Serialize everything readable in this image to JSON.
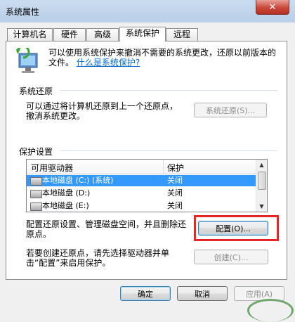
{
  "window": {
    "title": "系统属性",
    "close_label": "✕"
  },
  "tabs": [
    {
      "label": "计算机名"
    },
    {
      "label": "硬件"
    },
    {
      "label": "高级"
    },
    {
      "label": "系统保护"
    },
    {
      "label": "远程"
    }
  ],
  "info": {
    "text": "可以使用系统保护来撤消不需要的系统更改，还原以前版本的文件。",
    "link": "什么是系统保护?"
  },
  "restore": {
    "group_label": "系统还原",
    "description": "可以通过将计算机还原到上一个还原点，撤消系统更改。",
    "button": "系统还原(S)..."
  },
  "protection": {
    "group_label": "保护设置",
    "columns": {
      "drive": "可用驱动器",
      "protect": "保护"
    },
    "drives": [
      {
        "name": "本地磁盘 (C:) (系统)",
        "status": "关闭"
      },
      {
        "name": "本地磁盘 (D:)",
        "status": "关闭"
      },
      {
        "name": "本地磁盘 (E:)",
        "status": "关闭"
      }
    ],
    "configure_text": "配置还原设置、管理磁盘空间，并且删除还原点。",
    "configure_button": "配置(O)...",
    "create_text": "若要创建还原点，请先选择驱动器并单击“配置”来启用保护。",
    "create_button": "创建(C)..."
  },
  "footer": {
    "ok": "确定",
    "cancel": "取消",
    "apply": "应用(A)"
  },
  "colors": {
    "selection": "#3399ff",
    "link": "#0066cc",
    "highlight_box": "#e8262a"
  }
}
